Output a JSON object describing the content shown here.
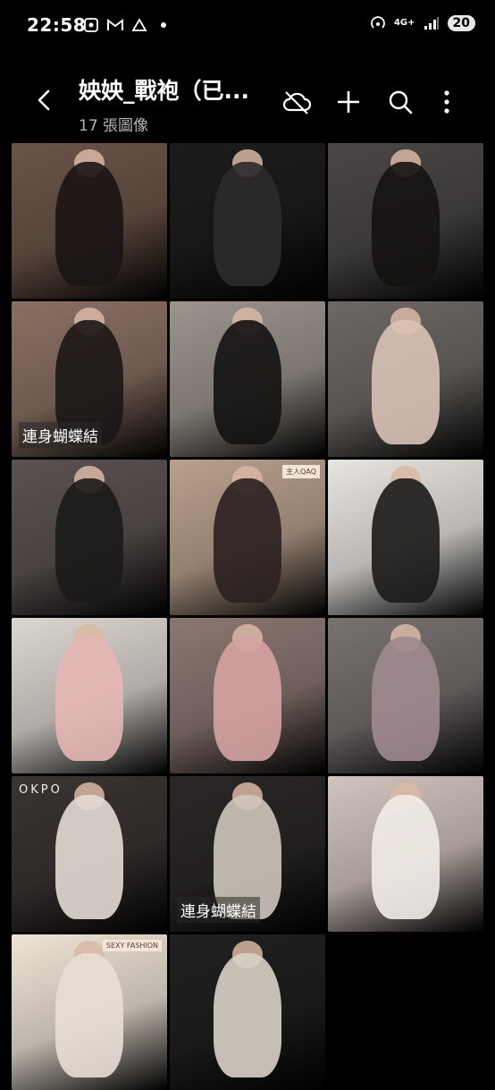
{
  "status": {
    "time": "22:58",
    "network": "4G+",
    "battery": "20"
  },
  "header": {
    "title": "姎姎_戰袍（已...",
    "subtitle": "17 張圖像"
  },
  "icons": {
    "back": "back-arrow-icon",
    "cloud": "cloud-off-icon",
    "add": "plus-icon",
    "search": "search-icon",
    "more": "more-vertical-icon"
  },
  "photos": [
    {
      "bg": "#6b5448",
      "accent": "#1a1414",
      "caption": ""
    },
    {
      "bg": "#1d1b1c",
      "accent": "#2c2a2b",
      "caption": ""
    },
    {
      "bg": "#4a4646",
      "accent": "#151212",
      "caption": ""
    },
    {
      "bg": "#8a7063",
      "accent": "#1b1616",
      "caption": "連身蝴蝶結"
    },
    {
      "bg": "#9c948d",
      "accent": "#141212",
      "caption": ""
    },
    {
      "bg": "#6d6864",
      "accent": "#d9c2b6",
      "caption": ""
    },
    {
      "bg": "#5a5250",
      "accent": "#1c1a1a",
      "caption": ""
    },
    {
      "bg": "#b9a08d",
      "accent": "#2a2020",
      "caption": "",
      "poster": "主人QAQ"
    },
    {
      "bg": "#e8e4e0",
      "accent": "#1c1a1a",
      "caption": ""
    },
    {
      "bg": "#dcd6d0",
      "accent": "#e6b7b6",
      "caption": ""
    },
    {
      "bg": "#8b7772",
      "accent": "#d6a3a3",
      "caption": ""
    },
    {
      "bg": "#77716f",
      "accent": "#a08a8f",
      "caption": ""
    },
    {
      "bg": "#3a3432",
      "accent": "#e4dbd4",
      "caption": "",
      "brand": "OKPO"
    },
    {
      "bg": "#2b2727",
      "accent": "#cfc6bd",
      "caption": "連身蝴蝶結"
    },
    {
      "bg": "#d1c3bd",
      "accent": "#f2ece8",
      "caption": ""
    },
    {
      "bg": "#eee3d6",
      "accent": "#e8ded5",
      "caption": "",
      "poster": "SEXY FASHION"
    },
    {
      "bg": "#202020",
      "accent": "#d8d2c8",
      "caption": ""
    }
  ]
}
